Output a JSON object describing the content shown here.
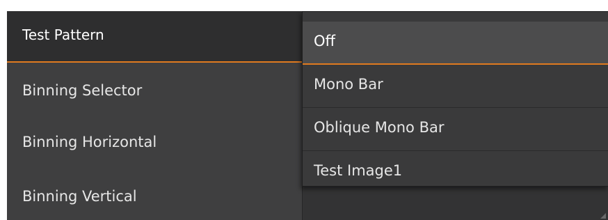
{
  "properties": [
    {
      "label": "Test Pattern"
    },
    {
      "label": "Binning Selector"
    },
    {
      "label": "Binning Horizontal"
    },
    {
      "label": "Binning Vertical"
    }
  ],
  "dropdown": {
    "selected": "Off",
    "options": [
      "Off",
      "Mono Bar",
      "Oblique Mono Bar",
      "Test Image1"
    ]
  },
  "colors": {
    "accent": "#e07a1f",
    "panel_bg": "#3f3f40"
  }
}
